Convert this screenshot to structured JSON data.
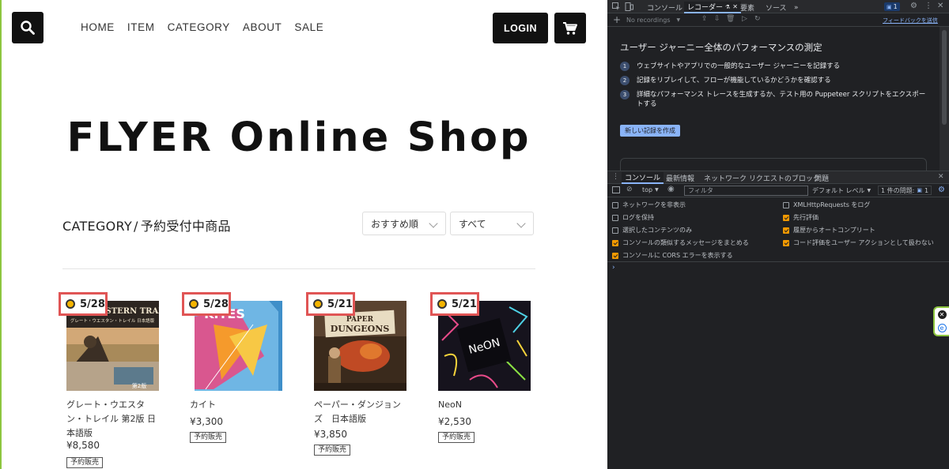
{
  "shop": {
    "nav": [
      "HOME",
      "ITEM",
      "CATEGORY",
      "ABOUT",
      "SALE"
    ],
    "login_label": "LOGIN",
    "hero_title": "FLYER Online Shop",
    "category_label": "CATEGORY",
    "category_sep": "/",
    "category_value": "予約受付中商品",
    "sort_select": "おすすめ順",
    "filter_select": "すべて",
    "products": [
      {
        "date": "5/28",
        "name": "グレート・ウエスタン・トレイル 第2版 日本語版",
        "price": "¥8,580",
        "tag": "予約販売",
        "image": "great-western-trail-box"
      },
      {
        "date": "5/28",
        "name": "カイト",
        "price": "¥3,300",
        "tag": "予約販売",
        "image": "kites-box"
      },
      {
        "date": "5/21",
        "name": "ペーパー・ダンジョンズ　日本語版",
        "price": "¥3,850",
        "tag": "予約販売",
        "image": "paper-dungeons-box"
      },
      {
        "date": "5/21",
        "name": "NeoN",
        "price": "¥2,530",
        "tag": "予約販売",
        "image": "neon-box"
      }
    ],
    "box_art_text": {
      "gwt": "GREAT WESTERN TRAIL",
      "gwt_sub": "グレート・ウエスタン・トレイル 日本語版",
      "gwt_edition": "第2版",
      "kites": "KITES",
      "paper": "PAPER",
      "dungeons": "DUNGEONS",
      "neon": "NeON"
    }
  },
  "devtools": {
    "tabs": [
      "コンソール",
      "レコーダー",
      "要素",
      "ソース"
    ],
    "active_tab": "レコーダー",
    "more_tabs": "»",
    "issues_count": "1",
    "recordings_select": "No recordings",
    "feedback_link": "フィードバックを送信",
    "recorder_title": "ユーザー ジャーニー全体のパフォーマンスの測定",
    "steps": [
      "ウェブサイトやアプリでの一般的なユーザー ジャーニーを記録する",
      "記録をリプレイして、フローが機能しているかどうかを確認する",
      "詳細なパフォーマンス トレースを生成するか、テスト用の Puppeteer スクリプトをエクスポートする"
    ],
    "new_recording_button": "新しい記録を作成",
    "drawer_tabs": [
      "コンソール",
      "最新情報",
      "ネットワーク リクエストのブロック",
      "問題"
    ],
    "context_select": "top",
    "filter_placeholder": "フィルタ",
    "level_select": "デフォルト レベル",
    "issues_label": "1 件の問題:",
    "options_left": [
      {
        "label": "ネットワークを非表示",
        "checked": false
      },
      {
        "label": "ログを保持",
        "checked": false
      },
      {
        "label": "選択したコンテンツのみ",
        "checked": false
      },
      {
        "label": "コンソールの類似するメッセージをまとめる",
        "checked": true
      },
      {
        "label": "コンソールに CORS エラーを表示する",
        "checked": true
      }
    ],
    "options_right": [
      {
        "label": "XMLHttpRequests をログ",
        "checked": false
      },
      {
        "label": "先行評価",
        "checked": true
      },
      {
        "label": "履歴からオートコンプリート",
        "checked": true
      },
      {
        "label": "コード評価をユーザー アクションとして扱わない",
        "checked": true
      }
    ],
    "prompt": "›"
  }
}
